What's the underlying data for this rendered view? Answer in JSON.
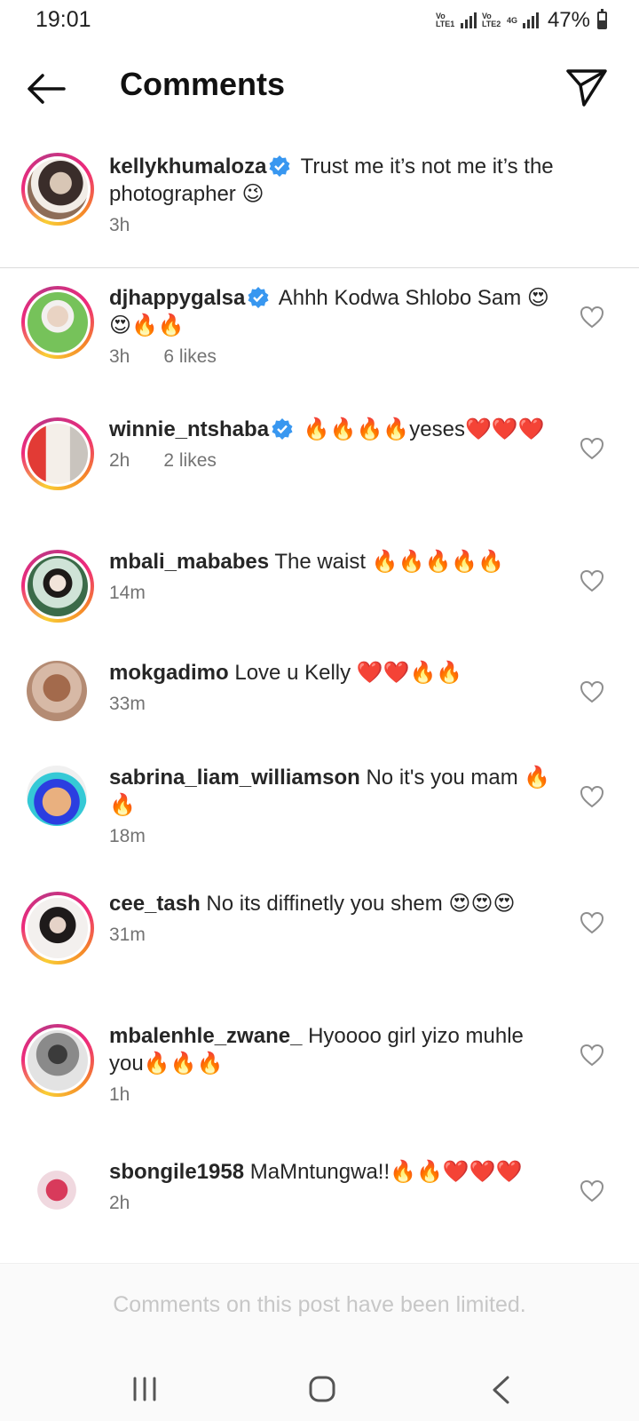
{
  "status_bar": {
    "time": "19:01",
    "sim1": "Vo LTE1",
    "sim2": "Vo LTE2",
    "network": "4G",
    "battery_pct": "47%",
    "battery_level": 0.47
  },
  "header": {
    "title": "Comments",
    "back_icon": "arrow-left-icon",
    "share_icon": "paper-plane-icon"
  },
  "caption": {
    "username": "kellykhumaloza",
    "verified": true,
    "text": " Trust me it’s not me it’s the photographer 😉",
    "time": "3h"
  },
  "comments": [
    {
      "username": "djhappygalsa",
      "verified": true,
      "text": " Ahhh Kodwa Shlobo Sam 😍😍🔥🔥",
      "time": "3h",
      "likes": "6 likes"
    },
    {
      "username": "winnie_ntshaba",
      "verified": true,
      "text": " 🔥🔥🔥🔥yeses❤️❤️❤️",
      "time": "2h",
      "likes": "2 likes"
    },
    {
      "username": "mbali_mababes",
      "verified": false,
      "text": " The waist 🔥🔥🔥🔥🔥",
      "time": "14m",
      "likes": ""
    },
    {
      "username": "mokgadimo",
      "verified": false,
      "text": " Love u Kelly ❤️❤️🔥🔥",
      "time": "33m",
      "likes": ""
    },
    {
      "username": "sabrina_liam_williamson",
      "verified": false,
      "text": " No it's you mam 🔥🔥",
      "time": "18m",
      "likes": ""
    },
    {
      "username": "cee_tash",
      "verified": false,
      "text": " No its diffinetly  you shem 😍😍😍",
      "time": "31m",
      "likes": ""
    },
    {
      "username": "mbalenhle_zwane_",
      "verified": false,
      "text": " Hyoooo girl yizo  muhle you🔥🔥🔥",
      "time": "1h",
      "likes": ""
    },
    {
      "username": "sbongile1958",
      "verified": false,
      "text": " MaMntungwa!!🔥🔥❤️❤️❤️",
      "time": "2h",
      "likes": ""
    }
  ],
  "footer": {
    "note": "Comments on this post have been limited."
  },
  "colors": {
    "verified_blue": "#3897f0",
    "muted_text": "#737373",
    "footer_text": "#c7c7c7"
  }
}
